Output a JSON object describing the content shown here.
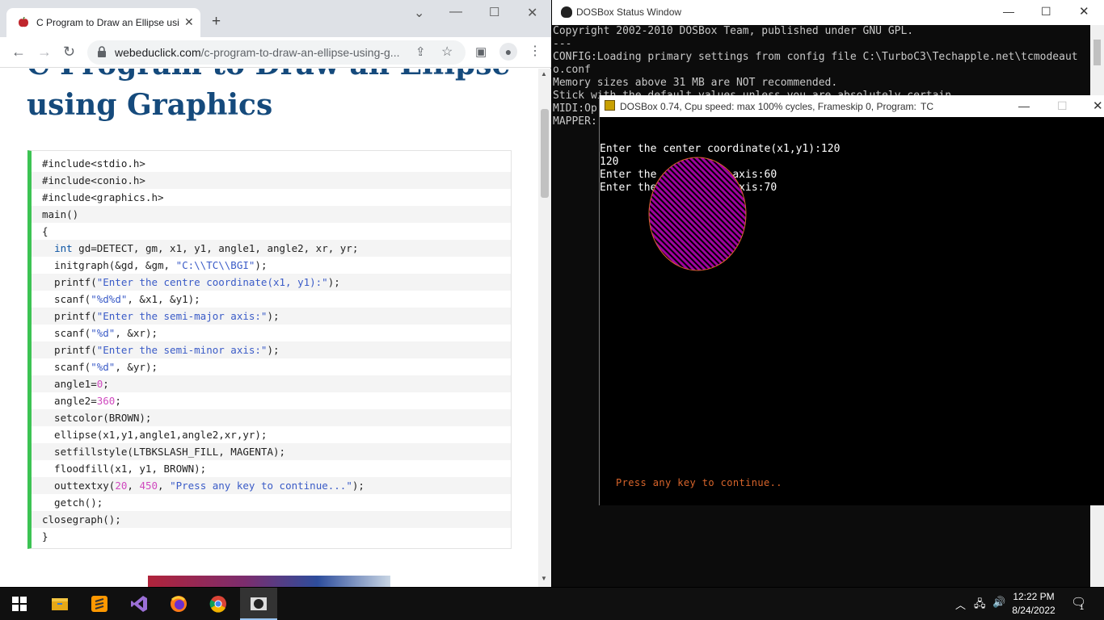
{
  "browser": {
    "tab_title": "C Program to Draw an Ellipse usi",
    "url_domain": "webeduclick.com",
    "url_path": "/c-program-to-draw-an-ellipse-using-g...",
    "heading": "C Program to Draw an Ellipse using Graphics",
    "code_lines": [
      "#include<stdio.h>",
      "#include<conio.h>",
      "#include<graphics.h>",
      "main()",
      "{",
      "  int gd=DETECT, gm, x1, y1, angle1, angle2, xr, yr;",
      "  initgraph(&gd, &gm, \"C:\\\\TC\\\\BGI\");",
      "  printf(\"Enter the centre coordinate(x1, y1):\");",
      "  scanf(\"%d%d\", &x1, &y1);",
      "  printf(\"Enter the semi-major axis:\");",
      "  scanf(\"%d\", &xr);",
      "  printf(\"Enter the semi-minor axis:\");",
      "  scanf(\"%d\", &yr);",
      "  angle1=0;",
      "  angle2=360;",
      "  setcolor(BROWN);",
      "  ellipse(x1,y1,angle1,angle2,xr,yr);",
      "  setfillstyle(LTBKSLASH_FILL, MAGENTA);",
      "  floodfill(x1, y1, BROWN);",
      "  outtextxy(20, 450, \"Press any key to continue...\");",
      "  getch();",
      "closegraph();",
      "}"
    ]
  },
  "status_window": {
    "title": "DOSBox Status Window",
    "console_lines": [
      "Copyright 2002-2010 DOSBox Team, published under GNU GPL.",
      "---",
      "CONFIG:Loading primary settings from config file C:\\TurboC3\\Techapple.net\\tcmodeaut",
      "o.conf",
      "Memory sizes above 31 MB are NOT recommended.",
      "Stick with the default values unless you are absolutely certain.",
      "MIDI:Op",
      "MAPPER:"
    ]
  },
  "dosbox": {
    "title": "DOSBox 0.74, Cpu speed: max 100% cycles, Frameskip  0, Program:",
    "program": "TC",
    "screen_lines": [
      "Enter the center coordinate(x1,y1):120",
      "120",
      "Enter the semi-major axis:60",
      "Enter the semi-minor axis:70"
    ],
    "press_text": "Press any key to continue..",
    "ellipse": {
      "stroke": "#d9652b",
      "fill": "#a000a0"
    }
  },
  "taskbar": {
    "apps": [
      "windows-start",
      "file-explorer",
      "sublime-text",
      "visual-studio",
      "firefox",
      "chrome",
      "dosbox"
    ],
    "time": "12:22 PM",
    "date": "8/24/2022",
    "notification_count": "1"
  },
  "colors": {
    "heading": "#154a7c",
    "code_border": "#3cc353",
    "keyword": "#0b54a3",
    "string": "#3a5bc7",
    "number": "#d04abf"
  }
}
